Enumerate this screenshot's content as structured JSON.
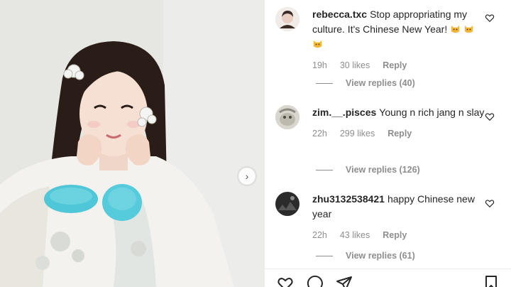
{
  "post": {
    "image_description_icon": "photo-icon",
    "next_icon": "chevron-right-icon"
  },
  "comments": [
    {
      "username": "rebecca.txc",
      "text": "Stop appropriating my culture. It's Chinese New Year!",
      "emoji": [
        "cat-emoji",
        "cat-emoji",
        "cat-emoji"
      ],
      "time": "19h",
      "likes": "30 likes",
      "reply_label": "Reply",
      "view_replies": "View replies (40)"
    },
    {
      "username": "zim.__.pisces",
      "text": "Young n rich jang n slay",
      "time": "22h",
      "likes": "299 likes",
      "reply_label": "Reply",
      "view_replies": "View replies (126)"
    },
    {
      "username": "zhu3132538421",
      "text": "happy Chinese new year",
      "time": "22h",
      "likes": "43 likes",
      "reply_label": "Reply",
      "view_replies": "View replies (61)"
    }
  ],
  "actions": {
    "like_icon": "heart-icon",
    "comment_icon": "comment-icon",
    "share_icon": "share-icon",
    "save_icon": "bookmark-icon"
  },
  "colors": {
    "text": "#262626",
    "secondary": "#8e8e8e",
    "accent_fur": "#4fc7d8"
  }
}
